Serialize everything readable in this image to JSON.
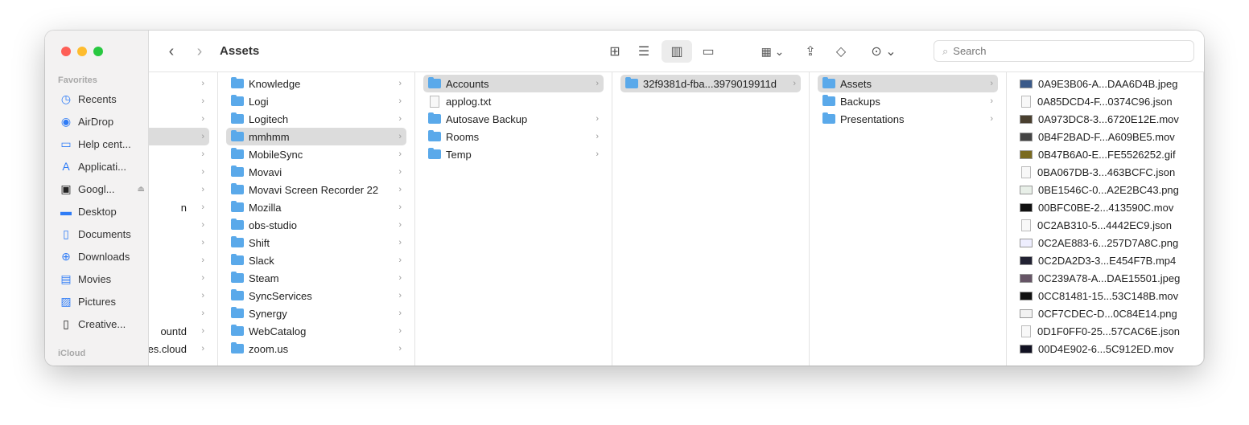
{
  "window": {
    "title": "Assets"
  },
  "sidebar": {
    "favorites_label": "Favorites",
    "icloud_label": "iCloud",
    "items": [
      {
        "label": "Recents",
        "icon": "clock-icon"
      },
      {
        "label": "AirDrop",
        "icon": "airdrop-icon"
      },
      {
        "label": "Help cent...",
        "icon": "folder-icon"
      },
      {
        "label": "Applicati...",
        "icon": "applications-icon"
      },
      {
        "label": "Googl...",
        "icon": "drive-icon"
      },
      {
        "label": "Desktop",
        "icon": "desktop-icon"
      },
      {
        "label": "Documents",
        "icon": "document-icon"
      },
      {
        "label": "Downloads",
        "icon": "download-icon"
      },
      {
        "label": "Movies",
        "icon": "film-icon"
      },
      {
        "label": "Pictures",
        "icon": "photo-icon"
      },
      {
        "label": "Creative...",
        "icon": "file-icon"
      }
    ]
  },
  "toolbar": {
    "search_placeholder": "Search",
    "search_value": ""
  },
  "columns": [
    {
      "items": [
        {
          "name": "",
          "sel": false
        },
        {
          "name": "",
          "sel": false
        },
        {
          "name": "",
          "sel": false
        },
        {
          "name": "",
          "sel": true
        },
        {
          "name": "",
          "sel": false
        },
        {
          "name": "",
          "sel": false
        },
        {
          "name": "",
          "sel": false
        },
        {
          "name": "n",
          "sel": false
        },
        {
          "name": "",
          "sel": false
        },
        {
          "name": "",
          "sel": false
        },
        {
          "name": "",
          "sel": false
        },
        {
          "name": "",
          "sel": false
        },
        {
          "name": "",
          "sel": false
        },
        {
          "name": "",
          "sel": false
        },
        {
          "name": "ountd",
          "sel": false
        },
        {
          "name": "ces.cloud",
          "sel": false
        }
      ]
    },
    {
      "items": [
        {
          "name": "Knowledge"
        },
        {
          "name": "Logi"
        },
        {
          "name": "Logitech"
        },
        {
          "name": "mmhmm",
          "sel": true
        },
        {
          "name": "MobileSync"
        },
        {
          "name": "Movavi"
        },
        {
          "name": "Movavi Screen Recorder 22"
        },
        {
          "name": "Mozilla"
        },
        {
          "name": "obs-studio"
        },
        {
          "name": "Shift"
        },
        {
          "name": "Slack"
        },
        {
          "name": "Steam"
        },
        {
          "name": "SyncServices"
        },
        {
          "name": "Synergy"
        },
        {
          "name": "WebCatalog"
        },
        {
          "name": "zoom.us"
        }
      ]
    },
    {
      "items": [
        {
          "name": "Accounts",
          "sel": true
        },
        {
          "name": "applog.txt",
          "file": true
        },
        {
          "name": "Autosave Backup"
        },
        {
          "name": "Rooms"
        },
        {
          "name": "Temp"
        }
      ]
    },
    {
      "items": [
        {
          "name": "32f9381d-fba...3979019911d",
          "sel": true
        }
      ]
    },
    {
      "items": [
        {
          "name": "Assets",
          "sel": true
        },
        {
          "name": "Backups"
        },
        {
          "name": "Presentations"
        }
      ]
    },
    {
      "files": [
        {
          "name": "0A9E3B06-A...DAA6D4B.jpeg",
          "color": "#3a5a8a"
        },
        {
          "name": "0A85DCD4-F...0374C96.json",
          "color": ""
        },
        {
          "name": "0A973DC8-3...6720E12E.mov",
          "color": "#4a4030"
        },
        {
          "name": "0B4F2BAD-F...A609BE5.mov",
          "color": "#444"
        },
        {
          "name": "0B47B6A0-E...FE5526252.gif",
          "color": "#7a6a20"
        },
        {
          "name": "0BA067DB-3...463BCFC.json",
          "color": ""
        },
        {
          "name": "0BE1546C-0...A2E2BC43.png",
          "color": "#e8efe8"
        },
        {
          "name": "00BFC0BE-2...413590C.mov",
          "color": "#111"
        },
        {
          "name": "0C2AB310-5...4442EC9.json",
          "color": ""
        },
        {
          "name": "0C2AE883-6...257D7A8C.png",
          "color": "#eef"
        },
        {
          "name": "0C2DA2D3-3...E454F7B.mp4",
          "color": "#223"
        },
        {
          "name": "0C239A78-A...DAE15501.jpeg",
          "color": "#665566"
        },
        {
          "name": "0CC81481-15...53C148B.mov",
          "color": "#111"
        },
        {
          "name": "0CF7CDEC-D...0C84E14.png",
          "color": "#f2f2f2"
        },
        {
          "name": "0D1F0FF0-25...57CAC6E.json",
          "color": ""
        },
        {
          "name": "00D4E902-6...5C912ED.mov",
          "color": "#112"
        }
      ]
    }
  ]
}
